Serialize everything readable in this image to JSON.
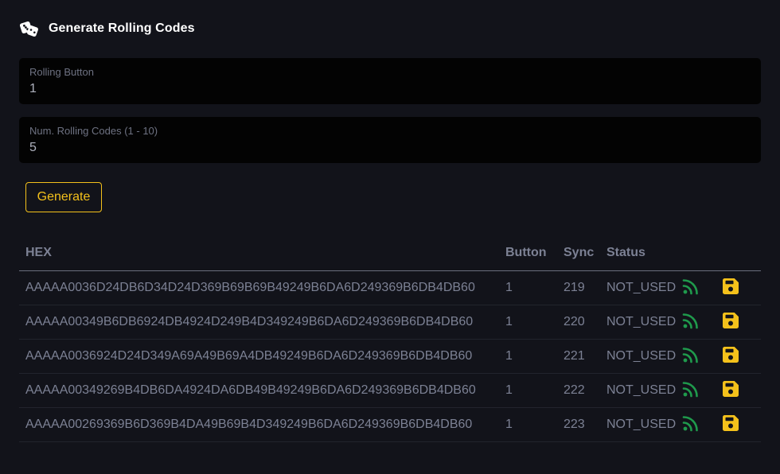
{
  "header": {
    "title": "Generate Rolling Codes",
    "icon": "dice-icon"
  },
  "form": {
    "rolling_button": {
      "label": "Rolling Button",
      "value": "1"
    },
    "num_codes": {
      "label": "Num. Rolling Codes (1 - 10)",
      "value": "5"
    },
    "generate_label": "Generate"
  },
  "table": {
    "headers": {
      "hex": "HEX",
      "button": "Button",
      "sync": "Sync",
      "status": "Status"
    },
    "rows": [
      {
        "hex": "AAAAA0036D24DB6D34D24D369B69B69B49249B6DA6D249369B6DB4DB60",
        "button": "1",
        "sync": "219",
        "status": "NOT_USED"
      },
      {
        "hex": "AAAAA00349B6DB6924DB4924D249B4D349249B6DA6D249369B6DB4DB60",
        "button": "1",
        "sync": "220",
        "status": "NOT_USED"
      },
      {
        "hex": "AAAAA0036924D24D349A69A49B69A4DB49249B6DA6D249369B6DB4DB60",
        "button": "1",
        "sync": "221",
        "status": "NOT_USED"
      },
      {
        "hex": "AAAAA00349269B4DB6DA4924DA6DB49B49249B6DA6D249369B6DB4DB60",
        "button": "1",
        "sync": "222",
        "status": "NOT_USED"
      },
      {
        "hex": "AAAAA00269369B6D369B4DA49B69B4D349249B6DA6D249369B6DB4DB60",
        "button": "1",
        "sync": "223",
        "status": "NOT_USED"
      }
    ],
    "row_icons": {
      "send": "rss-icon",
      "save": "floppy-disk-icon"
    }
  },
  "colors": {
    "background": "#12131a",
    "field_bg": "#030303",
    "accent": "#f4c11b",
    "send_icon": "#1f9a4c",
    "text": "#7c8194"
  }
}
